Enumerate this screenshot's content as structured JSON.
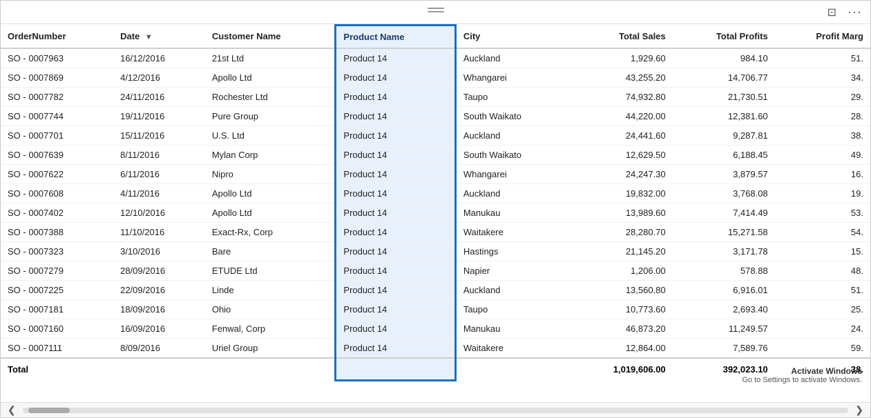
{
  "toolbar": {
    "fit_icon": "⊡",
    "more_icon": "···",
    "drag_handle_visible": true
  },
  "table": {
    "columns": [
      {
        "key": "order_number",
        "label": "OrderNumber",
        "sortable": false,
        "numeric": false
      },
      {
        "key": "date",
        "label": "Date",
        "sortable": true,
        "sort_dir": "desc",
        "numeric": false
      },
      {
        "key": "customer_name",
        "label": "Customer Name",
        "sortable": false,
        "numeric": false
      },
      {
        "key": "product_name",
        "label": "Product Name",
        "sortable": false,
        "numeric": false,
        "highlighted": true
      },
      {
        "key": "city",
        "label": "City",
        "sortable": false,
        "numeric": false
      },
      {
        "key": "total_sales",
        "label": "Total Sales",
        "sortable": false,
        "numeric": true
      },
      {
        "key": "total_profits",
        "label": "Total Profits",
        "sortable": false,
        "numeric": true
      },
      {
        "key": "profit_marg",
        "label": "Profit Marg",
        "sortable": false,
        "numeric": true
      }
    ],
    "rows": [
      {
        "order_number": "SO - 0007963",
        "date": "16/12/2016",
        "customer_name": "21st Ltd",
        "product_name": "Product 14",
        "city": "Auckland",
        "total_sales": "1,929.60",
        "total_profits": "984.10",
        "profit_marg": "51."
      },
      {
        "order_number": "SO - 0007869",
        "date": "4/12/2016",
        "customer_name": "Apollo Ltd",
        "product_name": "Product 14",
        "city": "Whangarei",
        "total_sales": "43,255.20",
        "total_profits": "14,706.77",
        "profit_marg": "34."
      },
      {
        "order_number": "SO - 0007782",
        "date": "24/11/2016",
        "customer_name": "Rochester Ltd",
        "product_name": "Product 14",
        "city": "Taupo",
        "total_sales": "74,932.80",
        "total_profits": "21,730.51",
        "profit_marg": "29."
      },
      {
        "order_number": "SO - 0007744",
        "date": "19/11/2016",
        "customer_name": "Pure Group",
        "product_name": "Product 14",
        "city": "South Waikato",
        "total_sales": "44,220.00",
        "total_profits": "12,381.60",
        "profit_marg": "28."
      },
      {
        "order_number": "SO - 0007701",
        "date": "15/11/2016",
        "customer_name": "U.S. Ltd",
        "product_name": "Product 14",
        "city": "Auckland",
        "total_sales": "24,441.60",
        "total_profits": "9,287.81",
        "profit_marg": "38."
      },
      {
        "order_number": "SO - 0007639",
        "date": "8/11/2016",
        "customer_name": "Mylan Corp",
        "product_name": "Product 14",
        "city": "South Waikato",
        "total_sales": "12,629.50",
        "total_profits": "6,188.45",
        "profit_marg": "49."
      },
      {
        "order_number": "SO - 0007622",
        "date": "6/11/2016",
        "customer_name": "Nipro",
        "product_name": "Product 14",
        "city": "Whangarei",
        "total_sales": "24,247.30",
        "total_profits": "3,879.57",
        "profit_marg": "16."
      },
      {
        "order_number": "SO - 0007608",
        "date": "4/11/2016",
        "customer_name": "Apollo Ltd",
        "product_name": "Product 14",
        "city": "Auckland",
        "total_sales": "19,832.00",
        "total_profits": "3,768.08",
        "profit_marg": "19."
      },
      {
        "order_number": "SO - 0007402",
        "date": "12/10/2016",
        "customer_name": "Apollo Ltd",
        "product_name": "Product 14",
        "city": "Manukau",
        "total_sales": "13,989.60",
        "total_profits": "7,414.49",
        "profit_marg": "53."
      },
      {
        "order_number": "SO - 0007388",
        "date": "11/10/2016",
        "customer_name": "Exact-Rx, Corp",
        "product_name": "Product 14",
        "city": "Waitakere",
        "total_sales": "28,280.70",
        "total_profits": "15,271.58",
        "profit_marg": "54."
      },
      {
        "order_number": "SO - 0007323",
        "date": "3/10/2016",
        "customer_name": "Bare",
        "product_name": "Product 14",
        "city": "Hastings",
        "total_sales": "21,145.20",
        "total_profits": "3,171.78",
        "profit_marg": "15."
      },
      {
        "order_number": "SO - 0007279",
        "date": "28/09/2016",
        "customer_name": "ETUDE Ltd",
        "product_name": "Product 14",
        "city": "Napier",
        "total_sales": "1,206.00",
        "total_profits": "578.88",
        "profit_marg": "48."
      },
      {
        "order_number": "SO - 0007225",
        "date": "22/09/2016",
        "customer_name": "Linde",
        "product_name": "Product 14",
        "city": "Auckland",
        "total_sales": "13,560.80",
        "total_profits": "6,916.01",
        "profit_marg": "51."
      },
      {
        "order_number": "SO - 0007181",
        "date": "18/09/2016",
        "customer_name": "Ohio",
        "product_name": "Product 14",
        "city": "Taupo",
        "total_sales": "10,773.60",
        "total_profits": "2,693.40",
        "profit_marg": "25."
      },
      {
        "order_number": "SO - 0007160",
        "date": "16/09/2016",
        "customer_name": "Fenwal, Corp",
        "product_name": "Product 14",
        "city": "Manukau",
        "total_sales": "46,873.20",
        "total_profits": "11,249.57",
        "profit_marg": "24."
      },
      {
        "order_number": "SO - 0007111",
        "date": "8/09/2016",
        "customer_name": "Uriel Group",
        "product_name": "Product 14",
        "city": "Waitakere",
        "total_sales": "12,864.00",
        "total_profits": "7,589.76",
        "profit_marg": "59."
      }
    ],
    "total_row": {
      "label": "Total",
      "total_sales": "1,019,606.00",
      "total_profits": "392,023.10",
      "profit_marg": "38."
    }
  },
  "scrollbar": {
    "left_arrow": "❮",
    "right_arrow": "❯"
  },
  "activate_windows": {
    "title": "Activate Windows",
    "subtitle": "Go to Settings to activate Windows."
  }
}
